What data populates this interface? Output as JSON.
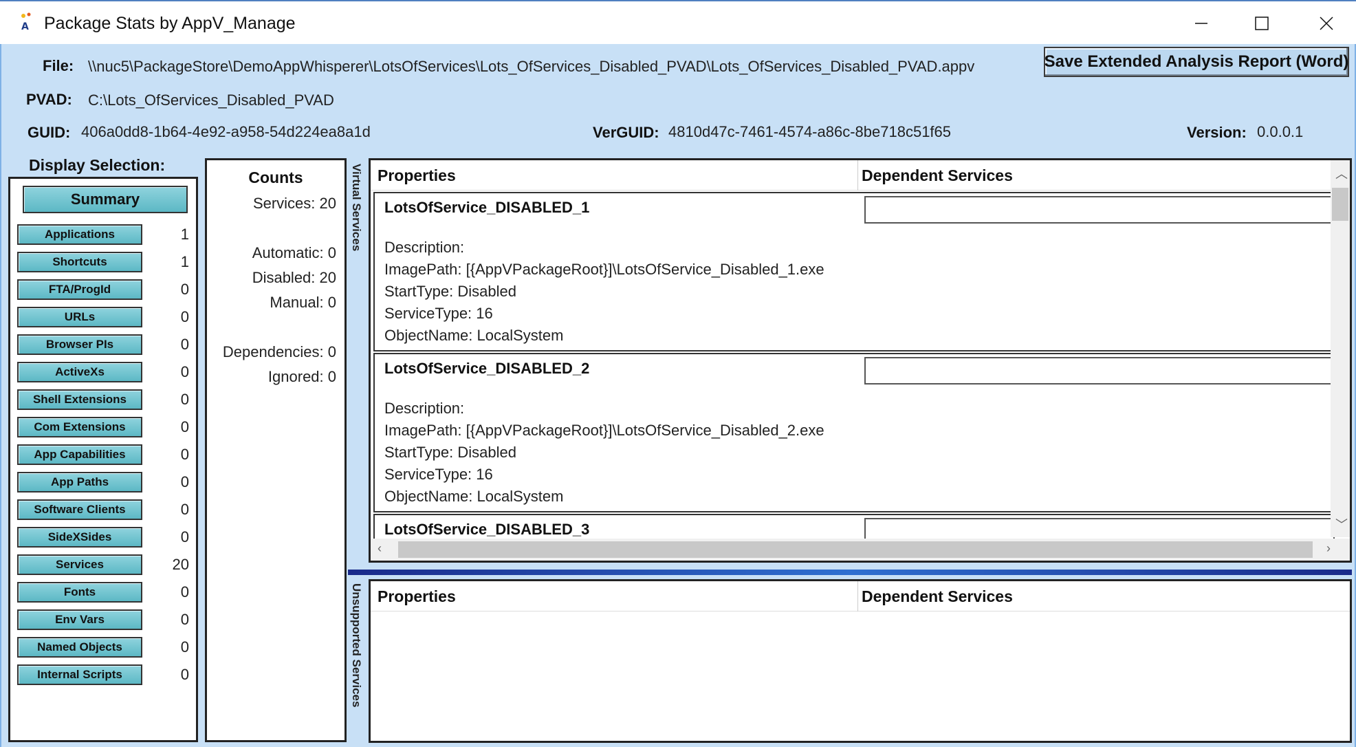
{
  "window": {
    "title": "Package Stats by AppV_Manage"
  },
  "header": {
    "file_label": "File:",
    "file_value": "\\\\nuc5\\PackageStore\\DemoAppWhisperer\\LotsOfServices\\Lots_OfServices_Disabled_PVAD\\Lots_OfServices_Disabled_PVAD.appv",
    "pvad_label": "PVAD:",
    "pvad_value": "C:\\Lots_OfServices_Disabled_PVAD",
    "guid_label": "GUID:",
    "guid_value": "406a0dd8-1b64-4e92-a958-54d224ea8a1d",
    "verguid_label": "VerGUID:",
    "verguid_value": "4810d47c-7461-4574-a86c-8be718c51f65",
    "version_label": "Version:",
    "version_value": "0.0.0.1",
    "save_button": "Save Extended Analysis Report (Word)"
  },
  "display_selection": {
    "title": "Display Selection:",
    "summary_button": "Summary",
    "items": [
      {
        "label": "Applications",
        "count": "1"
      },
      {
        "label": "Shortcuts",
        "count": "1"
      },
      {
        "label": "FTA/ProgId",
        "count": "0"
      },
      {
        "label": "URLs",
        "count": "0"
      },
      {
        "label": "Browser PIs",
        "count": "0"
      },
      {
        "label": "ActiveXs",
        "count": "0"
      },
      {
        "label": "Shell Extensions",
        "count": "0"
      },
      {
        "label": "Com Extensions",
        "count": "0"
      },
      {
        "label": "App Capabilities",
        "count": "0"
      },
      {
        "label": "App Paths",
        "count": "0"
      },
      {
        "label": "Software Clients",
        "count": "0"
      },
      {
        "label": "SideXSides",
        "count": "0"
      },
      {
        "label": "Services",
        "count": "20"
      },
      {
        "label": "Fonts",
        "count": "0"
      },
      {
        "label": "Env Vars",
        "count": "0"
      },
      {
        "label": "Named Objects",
        "count": "0"
      },
      {
        "label": "Internal Scripts",
        "count": "0"
      }
    ]
  },
  "counts": {
    "title": "Counts",
    "services": "Services: 20",
    "automatic": "Automatic: 0",
    "disabled": "Disabled: 20",
    "manual": "Manual: 0",
    "dependencies": "Dependencies: 0",
    "ignored": "Ignored: 0"
  },
  "virtual_services": {
    "side_label": "Virtual Services",
    "col_properties": "Properties",
    "col_dependent": "Dependent Services",
    "rows": [
      {
        "name": "LotsOfService_DISABLED_1",
        "description": "Description:",
        "image_path": "ImagePath: [{AppVPackageRoot}]\\LotsOfService_Disabled_1.exe",
        "start_type": "StartType: Disabled",
        "service_type": "ServiceType: 16",
        "object_name": "ObjectName: LocalSystem"
      },
      {
        "name": "LotsOfService_DISABLED_2",
        "description": "Description:",
        "image_path": "ImagePath: [{AppVPackageRoot}]\\LotsOfService_Disabled_2.exe",
        "start_type": "StartType: Disabled",
        "service_type": "ServiceType: 16",
        "object_name": "ObjectName: LocalSystem"
      },
      {
        "name": "LotsOfService_DISABLED_3"
      }
    ]
  },
  "unsupported_services": {
    "side_label": "Unsupported Services",
    "col_properties": "Properties",
    "col_dependent": "Dependent Services"
  }
}
